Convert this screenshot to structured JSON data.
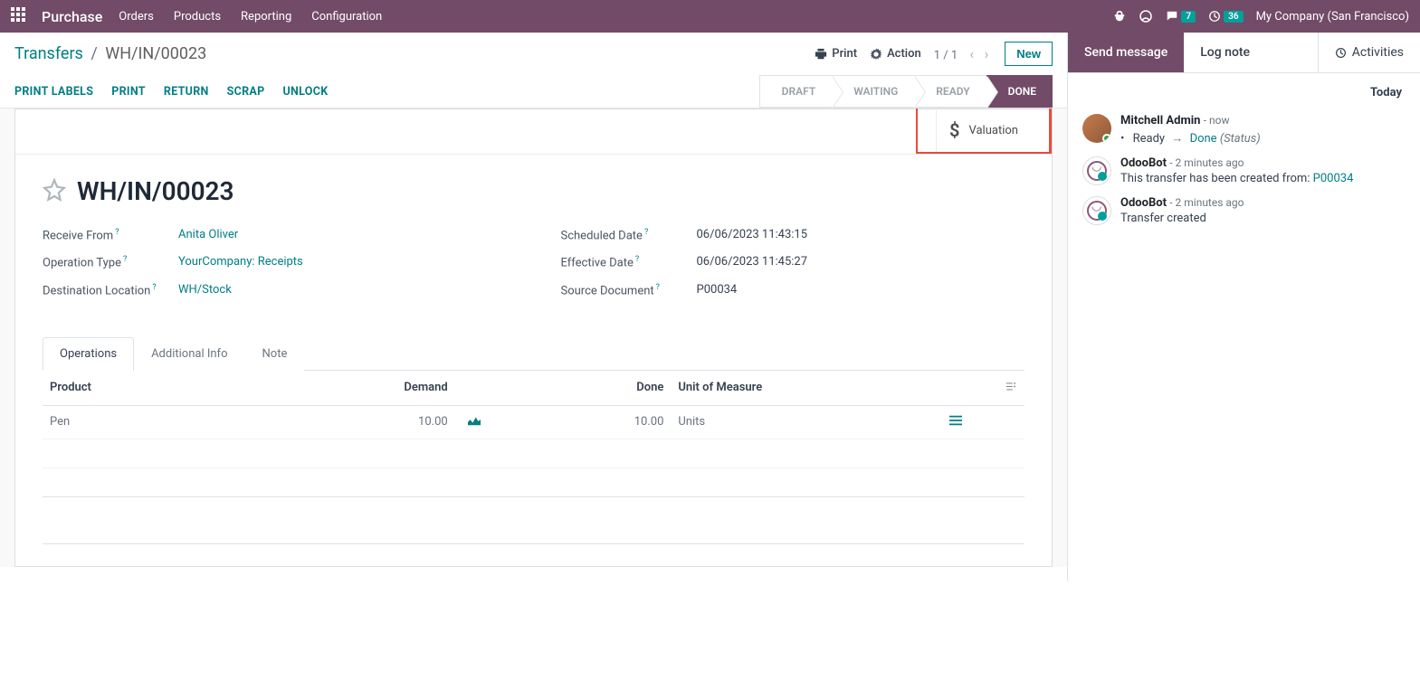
{
  "topnav": {
    "brand": "Purchase",
    "menu": [
      "Orders",
      "Products",
      "Reporting",
      "Configuration"
    ],
    "messages_count": "7",
    "activities_count": "36",
    "company": "My Company (San Francisco)"
  },
  "breadcrumb": {
    "root": "Transfers",
    "current": "WH/IN/00023"
  },
  "cp": {
    "print": "Print",
    "action": "Action",
    "pager": "1 / 1",
    "new": "New",
    "status_btns": [
      "PRINT LABELS",
      "PRINT",
      "RETURN",
      "SCRAP",
      "UNLOCK"
    ],
    "stages": [
      "DRAFT",
      "WAITING",
      "READY",
      "DONE"
    ],
    "active_stage": "DONE"
  },
  "stat": {
    "valuation": "Valuation"
  },
  "record": {
    "title": "WH/IN/00023",
    "labels": {
      "receive_from": "Receive From",
      "operation_type": "Operation Type",
      "destination": "Destination Location",
      "scheduled": "Scheduled Date",
      "effective": "Effective Date",
      "source_doc": "Source Document"
    },
    "receive_from": "Anita Oliver",
    "operation_type": "YourCompany: Receipts",
    "destination": "WH/Stock",
    "scheduled": "06/06/2023 11:43:15",
    "effective": "06/06/2023 11:45:27",
    "source_doc": "P00034"
  },
  "tabs": [
    "Operations",
    "Additional Info",
    "Note"
  ],
  "table": {
    "headers": {
      "product": "Product",
      "demand": "Demand",
      "done": "Done",
      "uom": "Unit of Measure"
    },
    "rows": [
      {
        "product": "Pen",
        "demand": "10.00",
        "done": "10.00",
        "uom": "Units"
      }
    ]
  },
  "chatter": {
    "tabs": {
      "send": "Send message",
      "log": "Log note",
      "activities": "Activities"
    },
    "today": "Today",
    "messages": [
      {
        "author": "Mitchell Admin",
        "time": "now",
        "status_from": "Ready",
        "status_to": "Done",
        "status_label": "(Status)"
      },
      {
        "author": "OdooBot",
        "time": "2 minutes ago",
        "text": "This transfer has been created from: ",
        "link": "P00034"
      },
      {
        "author": "OdooBot",
        "time": "2 minutes ago",
        "text": "Transfer created"
      }
    ]
  }
}
